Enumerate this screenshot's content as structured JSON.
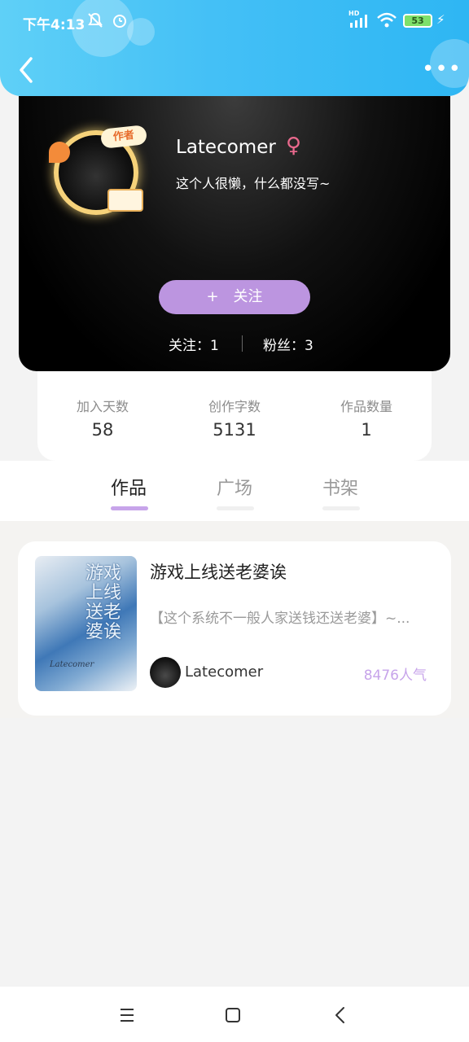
{
  "status_bar": {
    "time": "下午4:13",
    "network": "HD",
    "battery": "53",
    "icons": [
      "mute-icon",
      "alarm-icon",
      "signal-icon",
      "wifi-icon",
      "battery-icon",
      "charging-icon"
    ]
  },
  "header": {
    "back_icon": "chevron-left-icon",
    "more_icon": "more-dots-icon",
    "more_glyph": "•••"
  },
  "profile": {
    "avatar_tag": "作者",
    "username": "Latecomer",
    "gender_symbol": "♀",
    "bio": "这个人很懒，什么都没写~",
    "follow_plus": "+",
    "follow_label": "关注",
    "following": "关注：1",
    "followers": "粉丝：3"
  },
  "stats": [
    {
      "label": "加入天数",
      "value": "58"
    },
    {
      "label": "创作字数",
      "value": "5131"
    },
    {
      "label": "作品数量",
      "value": "1"
    }
  ],
  "tabs": [
    {
      "label": "作品",
      "active": true
    },
    {
      "label": "广场",
      "active": false
    },
    {
      "label": "书架",
      "active": false
    }
  ],
  "works": [
    {
      "cover_title": "游戏上线送老婆诶",
      "cover_signature": "Latecomer",
      "title": "游戏上线送老婆诶",
      "description": "【这个系统不一般人家送钱还送老婆】~...",
      "author": "Latecomer",
      "popularity": "8476人气"
    }
  ],
  "colors": {
    "header_gradient": [
      "#5fd0f7",
      "#2eb6f3"
    ],
    "accent_purple": "#bc95e0",
    "popularity_purple": "#c7a4ea",
    "gender_pink": "#e9698d"
  },
  "nav_bar": [
    "menu-icon",
    "home-square-icon",
    "back-triangle-icon"
  ]
}
